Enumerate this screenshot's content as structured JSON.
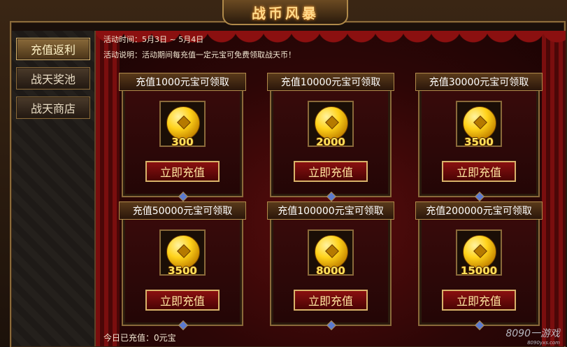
{
  "title": "战币风暴",
  "sidebar": {
    "items": [
      {
        "label": "充值返利",
        "active": true
      },
      {
        "label": "战天奖池",
        "active": false
      },
      {
        "label": "战天商店",
        "active": false
      }
    ]
  },
  "info": {
    "time": "活动时间：5月3日 ~ 5月4日",
    "desc": "活动说明：活动期间每充值一定元宝可免费领取战天币！"
  },
  "cards": [
    {
      "title": "充值1000元宝可领取",
      "amount": "300",
      "button": "立即充值"
    },
    {
      "title": "充值10000元宝可领取",
      "amount": "2000",
      "button": "立即充值"
    },
    {
      "title": "充值30000元宝可领取",
      "amount": "3500",
      "button": "立即充值"
    },
    {
      "title": "充值50000元宝可领取",
      "amount": "3500",
      "button": "立即充值"
    },
    {
      "title": "充值100000元宝可领取",
      "amount": "8000",
      "button": "立即充值"
    },
    {
      "title": "充值200000元宝可领取",
      "amount": "15000",
      "button": "立即充值"
    }
  ],
  "footer": "今日已充值：0元宝",
  "watermark": {
    "logo": "8090一游戏",
    "url": "8090yxs.com"
  },
  "colors": {
    "gold": "#d9b36a",
    "coin": "#ffd21a",
    "curtain": "#7a0e0e"
  }
}
